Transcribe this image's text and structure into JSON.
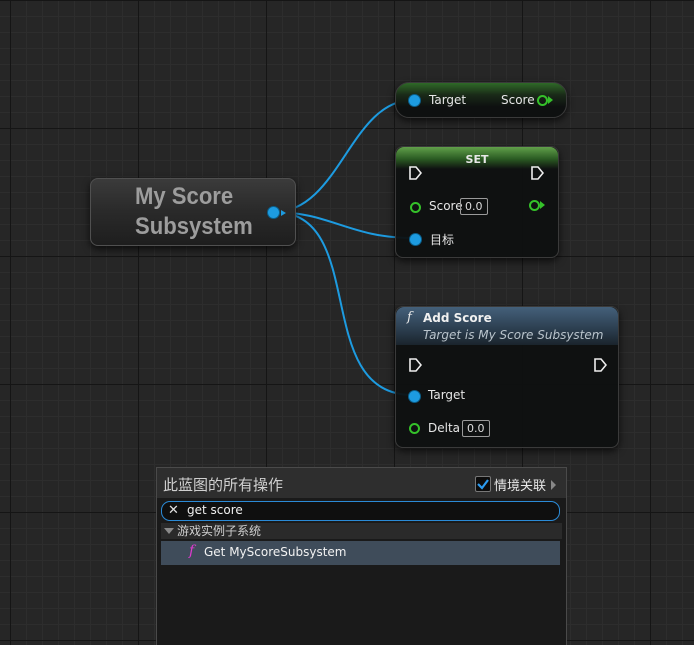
{
  "subsystem_node": {
    "title_line1": "My Score",
    "title_line2": "Subsystem"
  },
  "get_node": {
    "input_label": "Target",
    "output_label": "Score"
  },
  "set_node": {
    "title": "SET",
    "score_label": "Score",
    "score_value": "0.0",
    "target_label": "目标"
  },
  "add_node": {
    "icon": "f",
    "title": "Add Score",
    "subtitle": "Target is My Score Subsystem",
    "target_label": "Target",
    "delta_label": "Delta",
    "delta_value": "0.0"
  },
  "action_menu": {
    "title": "此蓝图的所有操作",
    "context_label": "情境关联",
    "context_checked": true,
    "clear_icon": "✕",
    "search_value": "get score",
    "category": "游戏实例子系统",
    "items": [
      {
        "icon": "f",
        "label": "Get MyScoreSubsystem"
      }
    ]
  },
  "colors": {
    "object_pin": "#1d9be0",
    "float_pin": "#35c12a",
    "function_icon": "#e03ad0",
    "selection": "#3f4c5a",
    "search_border": "#2b8ad6"
  }
}
